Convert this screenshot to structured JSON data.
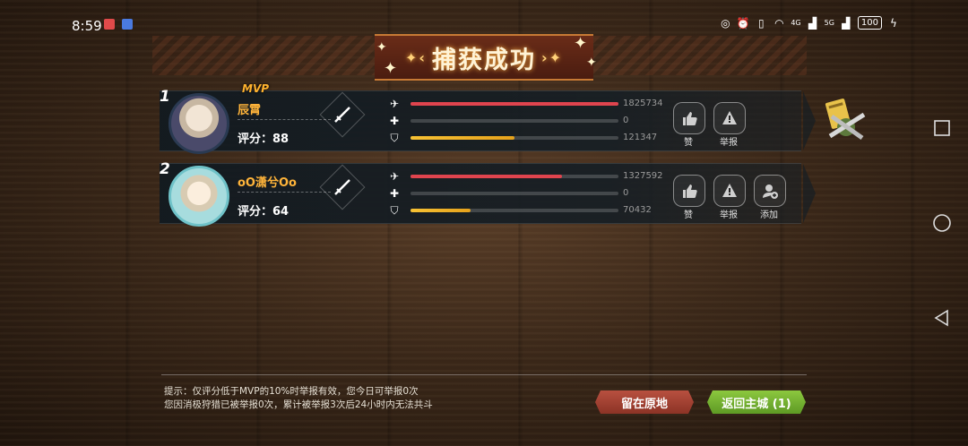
{
  "status_bar": {
    "time": "8:59",
    "signal_1": "4G",
    "signal_2": "5G",
    "battery": "100"
  },
  "title": "捕获成功",
  "players": [
    {
      "rank": "1",
      "mvp": "MVP",
      "name": "辰霄",
      "score": "评分：88",
      "damage": "1825734",
      "damage_fraction": 1.0,
      "heal": "0",
      "heal_fraction": 0,
      "defense": "121347",
      "defense_fraction": 0.5,
      "actions": [
        "赞",
        "举报"
      ]
    },
    {
      "rank": "2",
      "mvp": "",
      "name": "oO潇兮Oo",
      "score": "评分：64",
      "damage": "1327592",
      "damage_fraction": 0.73,
      "heal": "0",
      "heal_fraction": 0,
      "defense": "70432",
      "defense_fraction": 0.29,
      "actions": [
        "赞",
        "举报",
        "添加"
      ]
    }
  ],
  "tips": {
    "line1": "提示：仅评分低于MVP的10%时举报有效，您今日可举报0次",
    "line2": "您因消极狩猎已被举报0次，累计被举报3次后24小时内无法共斗"
  },
  "buttons": {
    "stay": "留在原地",
    "return": "返回主城 (1)"
  },
  "colors": {
    "damage": "#e0444e",
    "defense": "#f7c234",
    "name": "#ffb43a",
    "stay_button": "#9e3f31",
    "return_button": "#7ab333"
  }
}
